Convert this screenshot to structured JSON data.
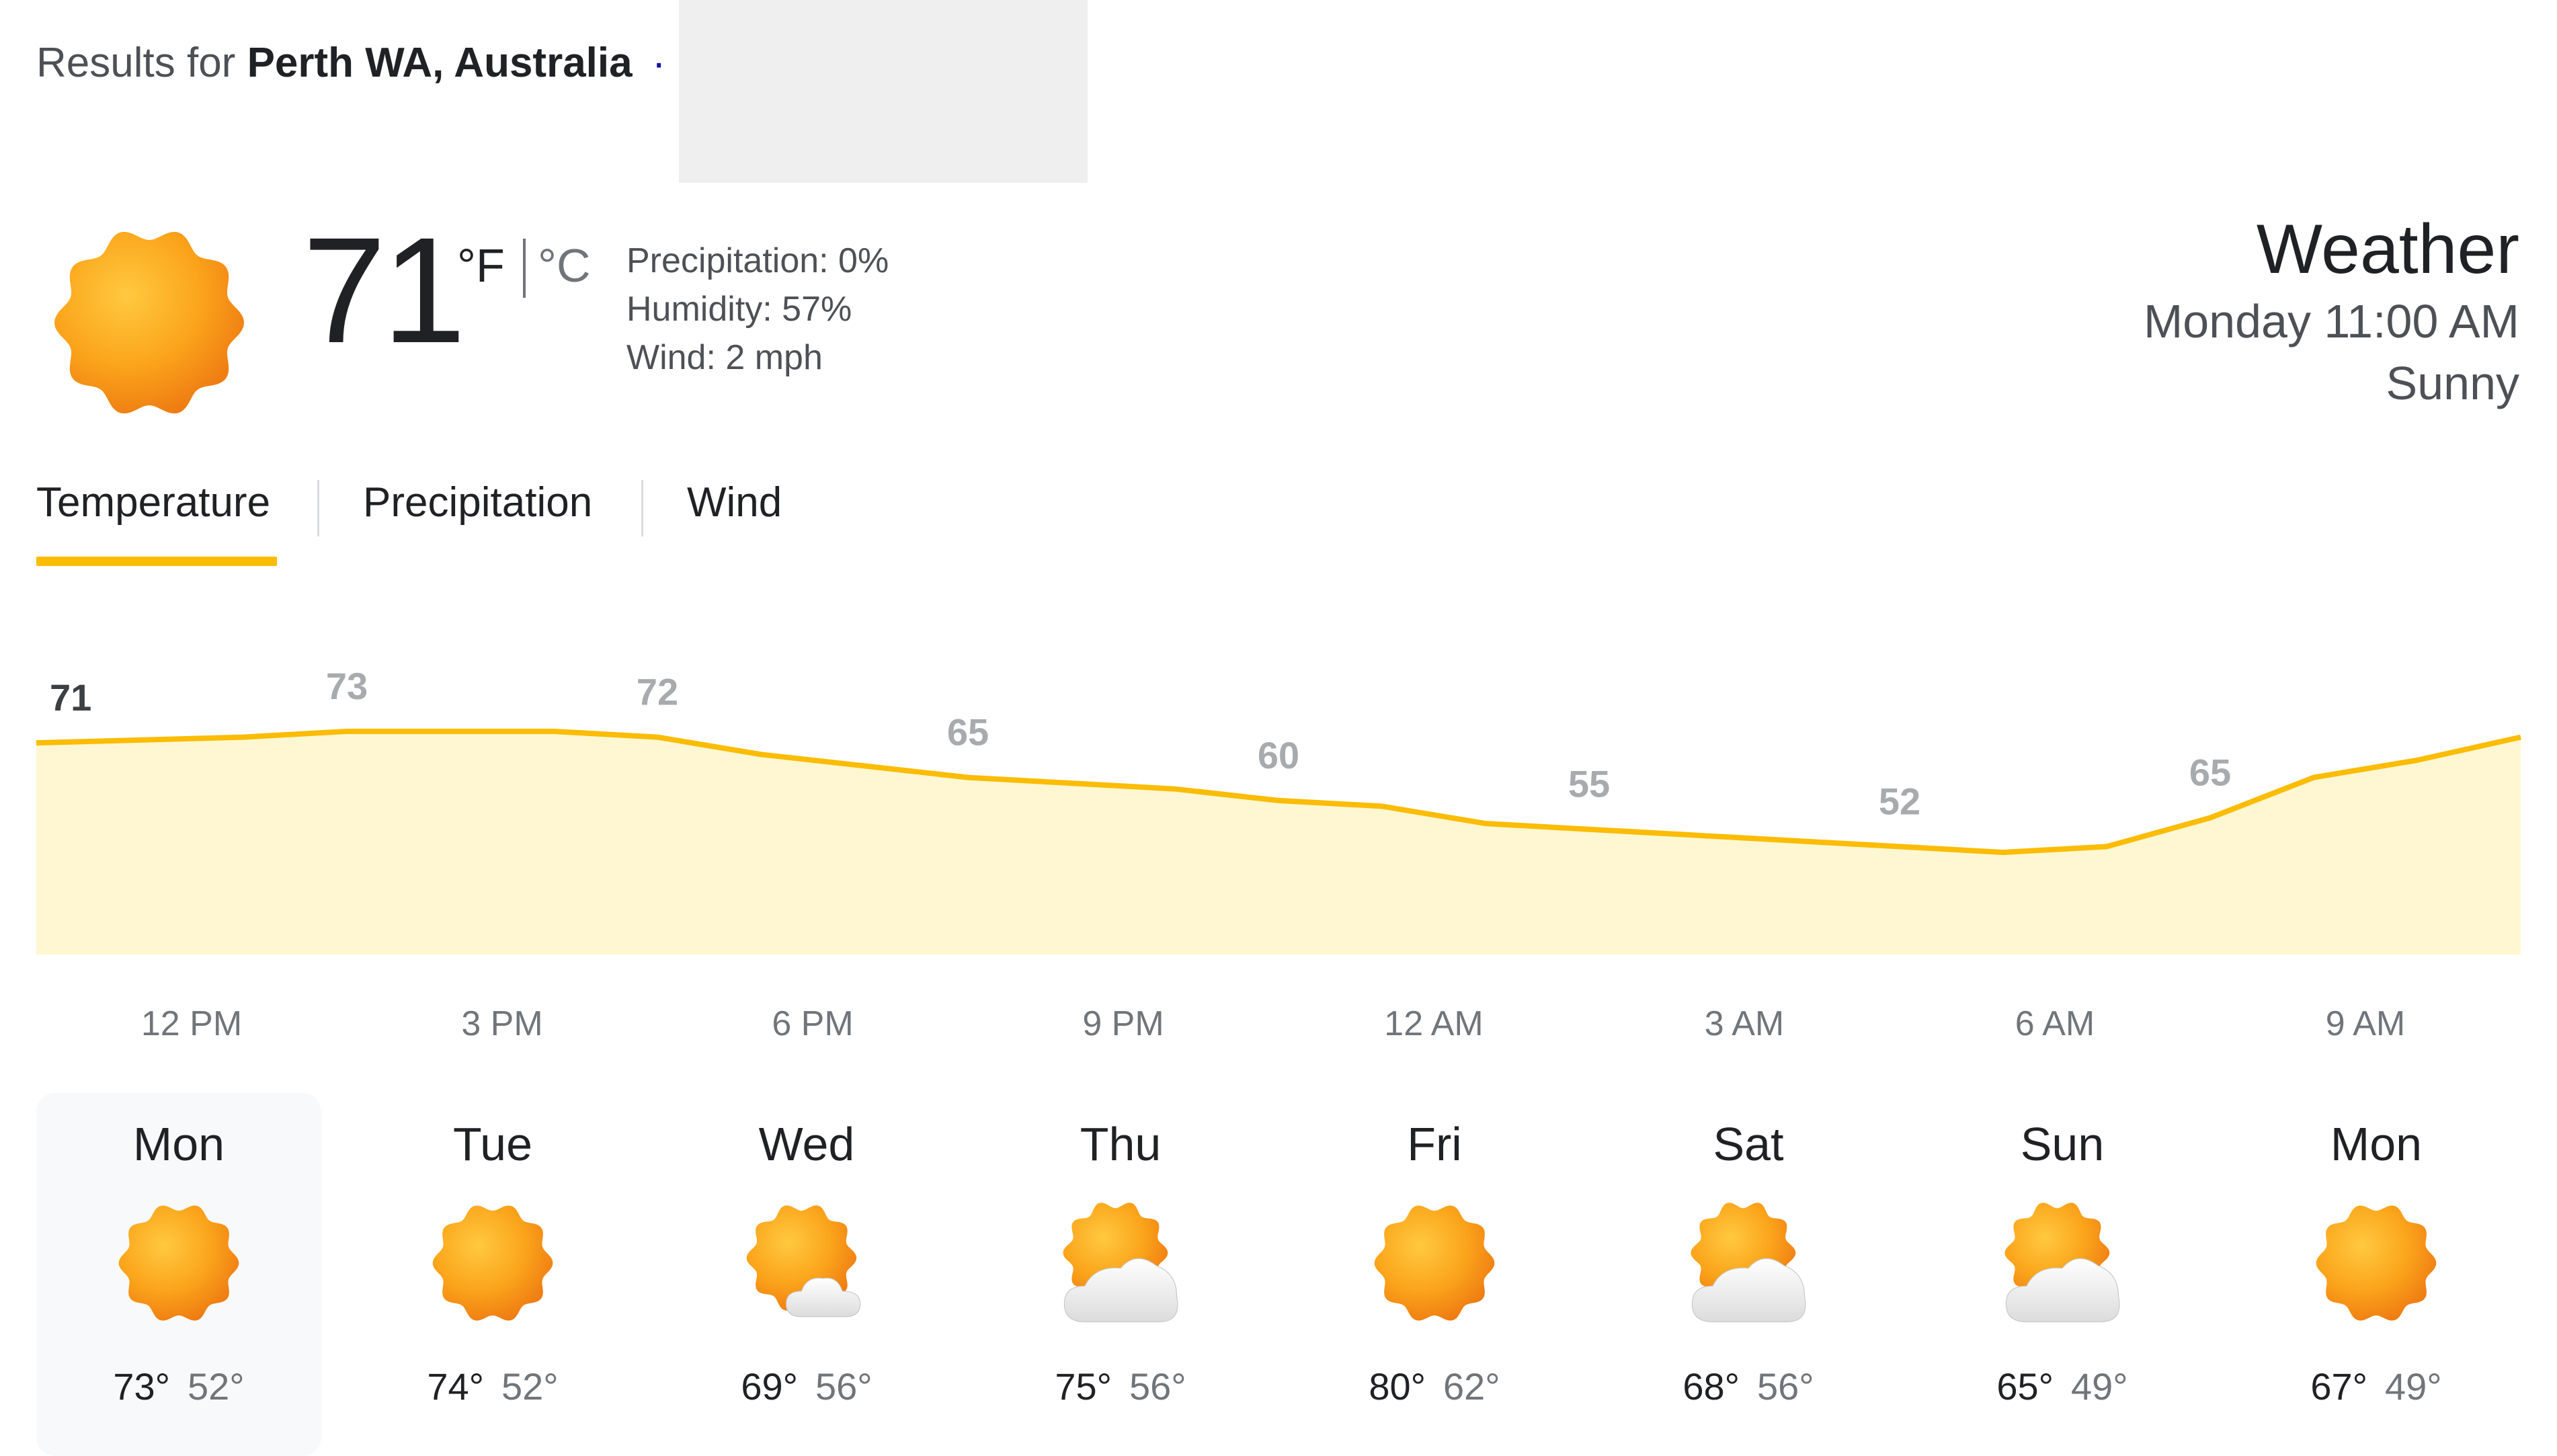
{
  "header": {
    "results_prefix": "Results for",
    "location": "Perth WA, Australia",
    "dot": "·"
  },
  "current": {
    "icon": "sun-icon",
    "temperature": "71",
    "unit_f": "°F",
    "unit_c": "°C",
    "precipitation": "Precipitation: 0%",
    "humidity": "Humidity: 57%",
    "wind": "Wind: 2 mph"
  },
  "weather_panel": {
    "title": "Weather",
    "time": "Monday 11:00 AM",
    "condition": "Sunny"
  },
  "tabs": [
    {
      "label": "Temperature",
      "selected": true
    },
    {
      "label": "Precipitation",
      "selected": false
    },
    {
      "label": "Wind",
      "selected": false
    }
  ],
  "chart_data": {
    "type": "area",
    "title": "",
    "xlabel": "",
    "ylabel": "",
    "line_color": "#fbbc04",
    "fill_color": "#fef7d2",
    "x": [
      "11 AM",
      "12 PM",
      "1 PM",
      "2 PM",
      "3 PM",
      "4 PM",
      "5 PM",
      "6 PM",
      "7 PM",
      "8 PM",
      "9 PM",
      "10 PM",
      "11 PM",
      "12 AM",
      "1 AM",
      "2 AM",
      "3 AM",
      "4 AM",
      "5 AM",
      "6 AM",
      "7 AM",
      "8 AM",
      "9 AM",
      "10 AM",
      "11 AM"
    ],
    "values": [
      71,
      71.5,
      72,
      73,
      73,
      73,
      72,
      69,
      67,
      65,
      64,
      63,
      61,
      60,
      57,
      56,
      55,
      54,
      53,
      52,
      53,
      58,
      65,
      68,
      72
    ],
    "ylim": [
      40,
      80
    ],
    "point_labels": [
      {
        "label": "71",
        "index": 0,
        "current": true
      },
      {
        "label": "73",
        "index": 3,
        "current": false
      },
      {
        "label": "72",
        "index": 6,
        "current": false
      },
      {
        "label": "65",
        "index": 9,
        "current": false
      },
      {
        "label": "60",
        "index": 12,
        "current": false
      },
      {
        "label": "55",
        "index": 15,
        "current": false
      },
      {
        "label": "52",
        "index": 18,
        "current": false
      },
      {
        "label": "65",
        "index": 21,
        "current": false
      }
    ],
    "tick_labels": [
      {
        "label": "12 PM",
        "index": 1.5
      },
      {
        "label": "3 PM",
        "index": 4.5
      },
      {
        "label": "6 PM",
        "index": 7.5
      },
      {
        "label": "9 PM",
        "index": 10.5
      },
      {
        "label": "12 AM",
        "index": 13.5
      },
      {
        "label": "3 AM",
        "index": 16.5
      },
      {
        "label": "6 AM",
        "index": 19.5
      },
      {
        "label": "9 AM",
        "index": 22.5
      }
    ]
  },
  "forecast": [
    {
      "day": "Mon",
      "icon": "sun-icon",
      "high": "73°",
      "low": "52°",
      "selected": true
    },
    {
      "day": "Tue",
      "icon": "sun-icon",
      "high": "74°",
      "low": "52°",
      "selected": false
    },
    {
      "day": "Wed",
      "icon": "mostly-sunny-icon",
      "high": "69°",
      "low": "56°",
      "selected": false
    },
    {
      "day": "Thu",
      "icon": "partly-cloudy-icon",
      "high": "75°",
      "low": "56°",
      "selected": false
    },
    {
      "day": "Fri",
      "icon": "sun-icon",
      "high": "80°",
      "low": "62°",
      "selected": false
    },
    {
      "day": "Sat",
      "icon": "partly-cloudy-icon",
      "high": "68°",
      "low": "56°",
      "selected": false
    },
    {
      "day": "Sun",
      "icon": "partly-cloudy-icon",
      "high": "65°",
      "low": "49°",
      "selected": false
    },
    {
      "day": "Mon",
      "icon": "sun-icon",
      "high": "67°",
      "low": "49°",
      "selected": false
    }
  ]
}
